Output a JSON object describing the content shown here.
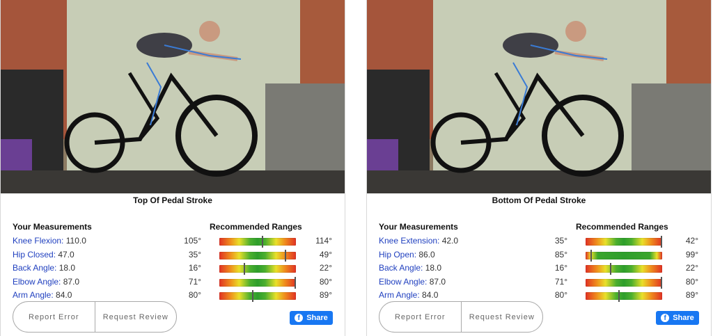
{
  "panels": [
    {
      "caption": "Top Of Pedal Stroke",
      "measurements_heading": "Your Measurements",
      "ranges_heading": "Recommended Ranges",
      "rows": [
        {
          "label": "Knee Flexion:",
          "value": "110.0",
          "min": "105°",
          "max": "114°",
          "position_fraction": 0.56
        },
        {
          "label": "Hip Closed:",
          "value": "47.0",
          "min": "35°",
          "max": "49°",
          "position_fraction": 0.86
        },
        {
          "label": "Back Angle:",
          "value": "18.0",
          "min": "16°",
          "max": "22°",
          "position_fraction": 0.33
        },
        {
          "label": "Elbow Angle:",
          "value": "87.0",
          "min": "71°",
          "max": "80°",
          "position_fraction": 1.0
        },
        {
          "label": "Arm Angle:",
          "value": "84.0",
          "min": "80°",
          "max": "89°",
          "position_fraction": 0.44
        }
      ],
      "buttons": {
        "report": "Report Error",
        "review": "Request Review"
      },
      "share": {
        "icon": "f",
        "label": "Share"
      }
    },
    {
      "caption": "Bottom Of Pedal Stroke",
      "measurements_heading": "Your Measurements",
      "ranges_heading": "Recommended Ranges",
      "rows": [
        {
          "label": "Knee Extension:",
          "value": "42.0",
          "min": "35°",
          "max": "42°",
          "position_fraction": 1.0
        },
        {
          "label": "Hip Open:",
          "value": "86.0",
          "min": "85°",
          "max": "99°",
          "position_fraction": 0.07
        },
        {
          "label": "Back Angle:",
          "value": "18.0",
          "min": "16°",
          "max": "22°",
          "position_fraction": 0.33
        },
        {
          "label": "Elbow Angle:",
          "value": "87.0",
          "min": "71°",
          "max": "80°",
          "position_fraction": 1.0
        },
        {
          "label": "Arm Angle:",
          "value": "84.0",
          "min": "80°",
          "max": "89°",
          "position_fraction": 0.44
        }
      ],
      "buttons": {
        "report": "Report Error",
        "review": "Request Review"
      },
      "share": {
        "icon": "f",
        "label": "Share"
      }
    }
  ],
  "colors": {
    "link": "#1f3fbf",
    "share_bg": "#1877f2",
    "range_good": "#2e9e2c",
    "range_bad": "#e03224"
  }
}
